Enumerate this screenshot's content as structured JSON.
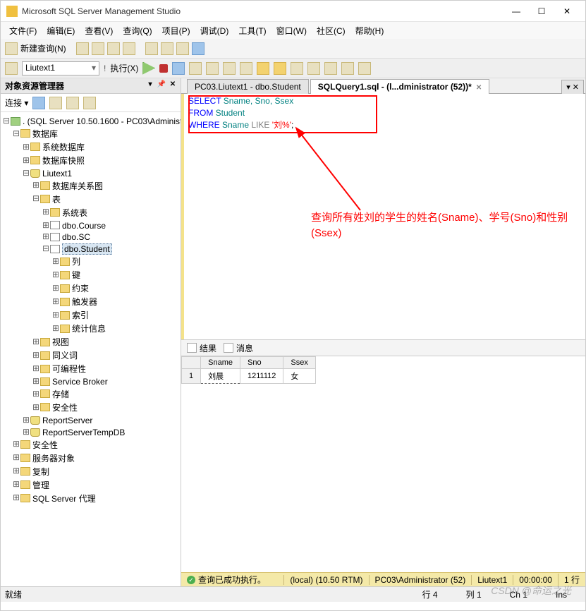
{
  "title": "Microsoft SQL Server Management Studio",
  "menus": [
    "文件(F)",
    "编辑(E)",
    "查看(V)",
    "查询(Q)",
    "项目(P)",
    "调试(D)",
    "工具(T)",
    "窗口(W)",
    "社区(C)",
    "帮助(H)"
  ],
  "toolbar": {
    "newquery": "新建查询(N)",
    "execute": "执行(X)",
    "dbselector": "Liutext1"
  },
  "panel": {
    "title": "对象资源管理器",
    "connect": "连接 ▾"
  },
  "tree": {
    "server": ". (SQL Server 10.50.1600 - PC03\\Administ",
    "databases": "数据库",
    "sysdb": "系统数据库",
    "snapshots": "数据库快照",
    "userdb": "Liutext1",
    "diagrams": "数据库关系图",
    "tables": "表",
    "systables": "系统表",
    "t1": "dbo.Course",
    "t2": "dbo.SC",
    "t3": "dbo.Student",
    "cols": "列",
    "keys": "键",
    "constraints": "约束",
    "triggers": "触发器",
    "indexes": "索引",
    "stats": "统计信息",
    "views": "视图",
    "synonyms": "同义词",
    "programmability": "可编程性",
    "servicebroker": "Service Broker",
    "storage": "存储",
    "security": "安全性",
    "reportserver": "ReportServer",
    "reportservertmp": "ReportServerTempDB",
    "security2": "安全性",
    "serverobjects": "服务器对象",
    "replication": "复制",
    "management": "管理",
    "agent": "SQL Server 代理"
  },
  "tabs": {
    "t1": "PC03.Liutext1 - dbo.Student",
    "t2": "SQLQuery1.sql - (l...dministrator (52))*"
  },
  "sql": {
    "l1a": "SELECT",
    "l1b": "  Sname, Sno, Ssex",
    "l2a": "FROM",
    "l2b": "  Student",
    "l3a": "WHERE",
    "l3b": "  Sname  ",
    "l3c": "LIKE",
    "l3d": "  ",
    "l3e": "'刘%'",
    "l3f": ";"
  },
  "annotation": "查询所有姓刘的学生的姓名(Sname)、学号(Sno)和性别(Ssex)",
  "results": {
    "tab1": "结果",
    "tab2": "消息",
    "cols": [
      "Sname",
      "Sno",
      "Ssex"
    ],
    "row": {
      "n": "1",
      "sname": "刘晨",
      "sno": "1211112",
      "ssex": "女"
    }
  },
  "qstatus": {
    "ok": "查询已成功执行。",
    "server": "(local) (10.50 RTM)",
    "user": "PC03\\Administrator (52)",
    "db": "Liutext1",
    "time": "00:00:00",
    "rows": "1 行"
  },
  "appstatus": {
    "ready": "就绪",
    "line": "行 4",
    "col": "列 1",
    "ch": "Ch 1",
    "ins": "Ins"
  },
  "watermark": "CSDN @命运之光"
}
